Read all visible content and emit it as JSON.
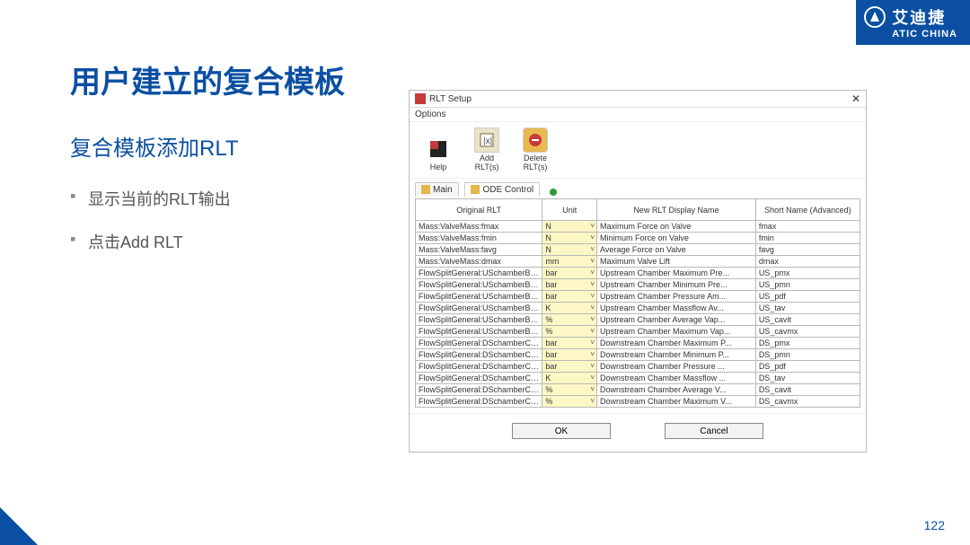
{
  "brand": {
    "cn": "艾迪捷",
    "en": "ATIC CHINA"
  },
  "title": "用户建立的复合模板",
  "subtitle": "复合模板添加RLT",
  "bullets": [
    "显示当前的RLT输出",
    "点击Add RLT"
  ],
  "page_num": "122",
  "dialog": {
    "title": "RLT Setup",
    "menu": "Options",
    "tools": {
      "help": "Help",
      "add": "Add\nRLT(s)",
      "del": "Delete\nRLT(s)"
    },
    "tabs": {
      "main": "Main",
      "ode": "ODE Control"
    },
    "columns": [
      "Original RLT",
      "Unit",
      "New RLT Display Name",
      "Short Name (Advanced)"
    ],
    "rows": [
      {
        "orig": "Mass:ValveMass:fmax",
        "unit": "N",
        "disp": "Maximum Force on Valve",
        "short": "fmax"
      },
      {
        "orig": "Mass:ValveMass:fmin",
        "unit": "N",
        "disp": "Minimum Force on Valve",
        "short": "fmin"
      },
      {
        "orig": "Mass:ValveMass:favg",
        "unit": "N",
        "disp": "Average Force on Valve",
        "short": "favg"
      },
      {
        "orig": "Mass:ValveMass:dmax",
        "unit": "mm",
        "disp": "Maximum Valve Lift",
        "short": "dmax"
      },
      {
        "orig": "FlowSplitGeneral:USchamberBV...",
        "unit": "bar",
        "disp": "Upstream Chamber Maximum Pre...",
        "short": "US_pmx"
      },
      {
        "orig": "FlowSplitGeneral:USchamberBV...",
        "unit": "bar",
        "disp": "Upstream Chamber Minimum Pre...",
        "short": "US_pmn"
      },
      {
        "orig": "FlowSplitGeneral:USchamberBV...",
        "unit": "bar",
        "disp": "Upstream Chamber Pressure Am...",
        "short": "US_pdf"
      },
      {
        "orig": "FlowSplitGeneral:USchamberBV...",
        "unit": "K",
        "disp": "Upstream Chamber Massflow Av...",
        "short": "US_tav"
      },
      {
        "orig": "FlowSplitGeneral:USchamberBV...",
        "unit": "%",
        "disp": "Upstream Chamber Average Vap...",
        "short": "US_cavit"
      },
      {
        "orig": "FlowSplitGeneral:USchamberBV...",
        "unit": "%",
        "disp": "Upstream Chamber Maximum Vap...",
        "short": "US_cavmx"
      },
      {
        "orig": "FlowSplitGeneral:DSchamberCV...",
        "unit": "bar",
        "disp": "Downstream Chamber Maximum P...",
        "short": "DS_pmx"
      },
      {
        "orig": "FlowSplitGeneral:DSchamberCV...",
        "unit": "bar",
        "disp": "Downstream Chamber Minimum P...",
        "short": "DS_pmn"
      },
      {
        "orig": "FlowSplitGeneral:DSchamberCV...",
        "unit": "bar",
        "disp": "Downstream Chamber Pressure ...",
        "short": "DS_pdf"
      },
      {
        "orig": "FlowSplitGeneral:DSchamberCV...",
        "unit": "K",
        "disp": "Downstream Chamber Massflow ...",
        "short": "DS_tav"
      },
      {
        "orig": "FlowSplitGeneral:DSchamberCV...",
        "unit": "%",
        "disp": "Downstream Chamber Average V...",
        "short": "DS_cavit"
      },
      {
        "orig": "FlowSplitGeneral:DSchamberCV...",
        "unit": "%",
        "disp": "Downstream Chamber Maximum V...",
        "short": "DS_cavmx"
      }
    ],
    "buttons": {
      "ok": "OK",
      "cancel": "Cancel"
    }
  }
}
